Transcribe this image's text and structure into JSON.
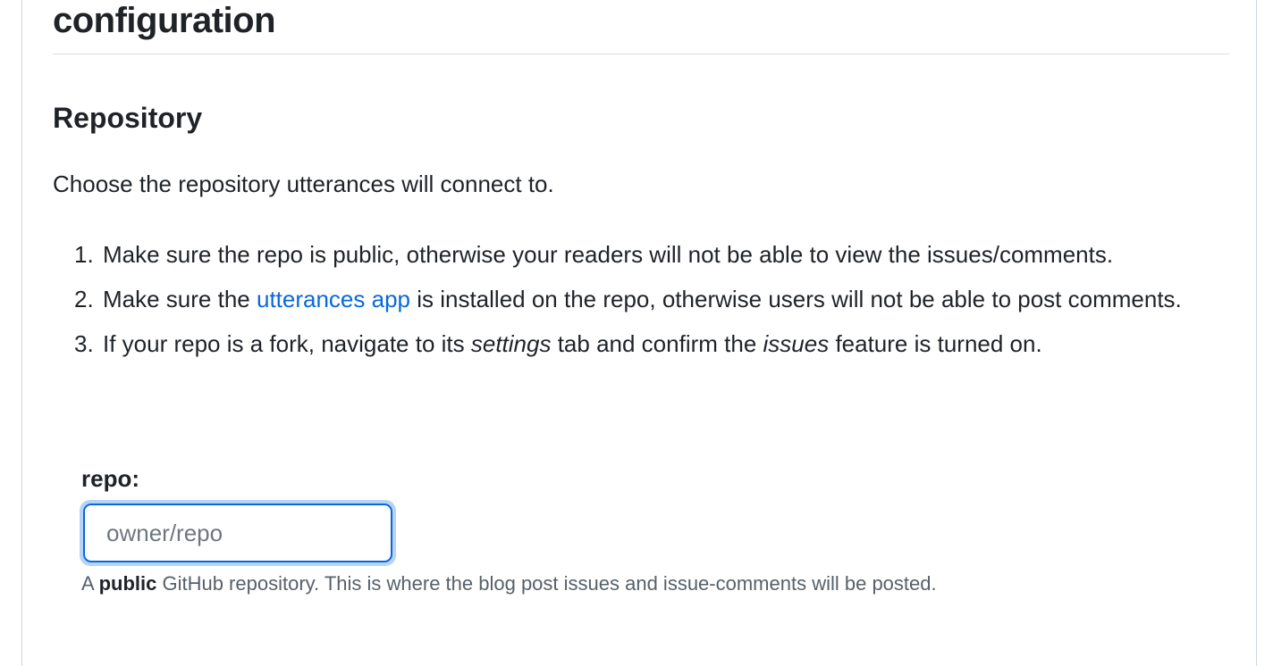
{
  "page": {
    "title": "configuration"
  },
  "repository_section": {
    "heading": "Repository",
    "intro": "Choose the repository utterances will connect to.",
    "steps": [
      {
        "number": "1.",
        "text": "Make sure the repo is public, otherwise your readers will not be able to view the issues/comments."
      },
      {
        "number": "2.",
        "text_before_link": "Make sure the ",
        "link_text": "utterances app",
        "text_after_link": " is installed on the repo, otherwise users will not be able to post comments."
      },
      {
        "number": "3.",
        "text_part1": "If your repo is a fork, navigate to its ",
        "emphasis1": "settings",
        "text_part2": " tab and confirm the ",
        "emphasis2": "issues",
        "text_part3": " feature is turned on."
      }
    ],
    "repo_field": {
      "label": "repo:",
      "placeholder": "owner/repo",
      "value": ""
    },
    "hint": {
      "prefix": "A ",
      "strong": "public",
      "suffix": " GitHub repository. This is where the blog post issues and issue-comments will be posted."
    }
  },
  "colors": {
    "link": "#0969da",
    "focus_ring": "#b6d4f7",
    "input_border": "#0969da",
    "muted_text": "#57606a"
  }
}
